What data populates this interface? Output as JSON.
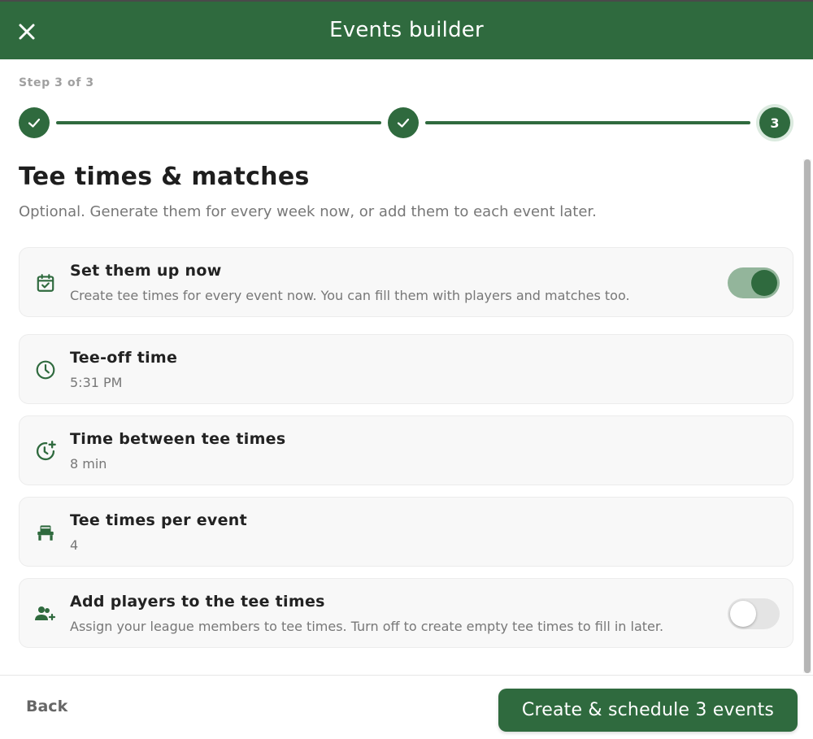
{
  "header": {
    "title": "Events builder",
    "close_icon": "close-icon"
  },
  "stepper": {
    "label": "Step 3 of 3",
    "current_step": 3,
    "total_steps": 3,
    "steps": [
      {
        "state": "completed",
        "icon": "check-icon"
      },
      {
        "state": "completed",
        "icon": "check-icon"
      },
      {
        "state": "current",
        "number": "3"
      }
    ]
  },
  "section": {
    "title": "Tee times & matches",
    "subtitle": "Optional. Generate them for every week now, or add them to each event later."
  },
  "cards": [
    {
      "icon": "calendar-check-icon",
      "title": "Set them up now",
      "subtitle": "Create tee times for every event now. You can fill them with players and matches too.",
      "toggle": true
    },
    {
      "icon": "clock-icon",
      "title": "Tee-off time",
      "subtitle": "5:31 PM"
    },
    {
      "icon": "clock-plus-icon",
      "title": "Time between tee times",
      "subtitle": "8 min"
    },
    {
      "icon": "golf-cart-icon",
      "title": "Tee times per event",
      "subtitle": "4"
    },
    {
      "icon": "add-players-icon",
      "title": "Add players to the tee times",
      "subtitle": "Assign your league members to tee times. Turn off to create empty tee times to fill in later.",
      "toggle": false
    }
  ],
  "footer": {
    "back_label": "Back",
    "primary_label": "Create & schedule 3 events"
  },
  "colors": {
    "primary": "#2f6a3e",
    "toggle_on_track": "#93b59b",
    "card_bg": "#f8f8f8",
    "muted_text": "#777777"
  }
}
